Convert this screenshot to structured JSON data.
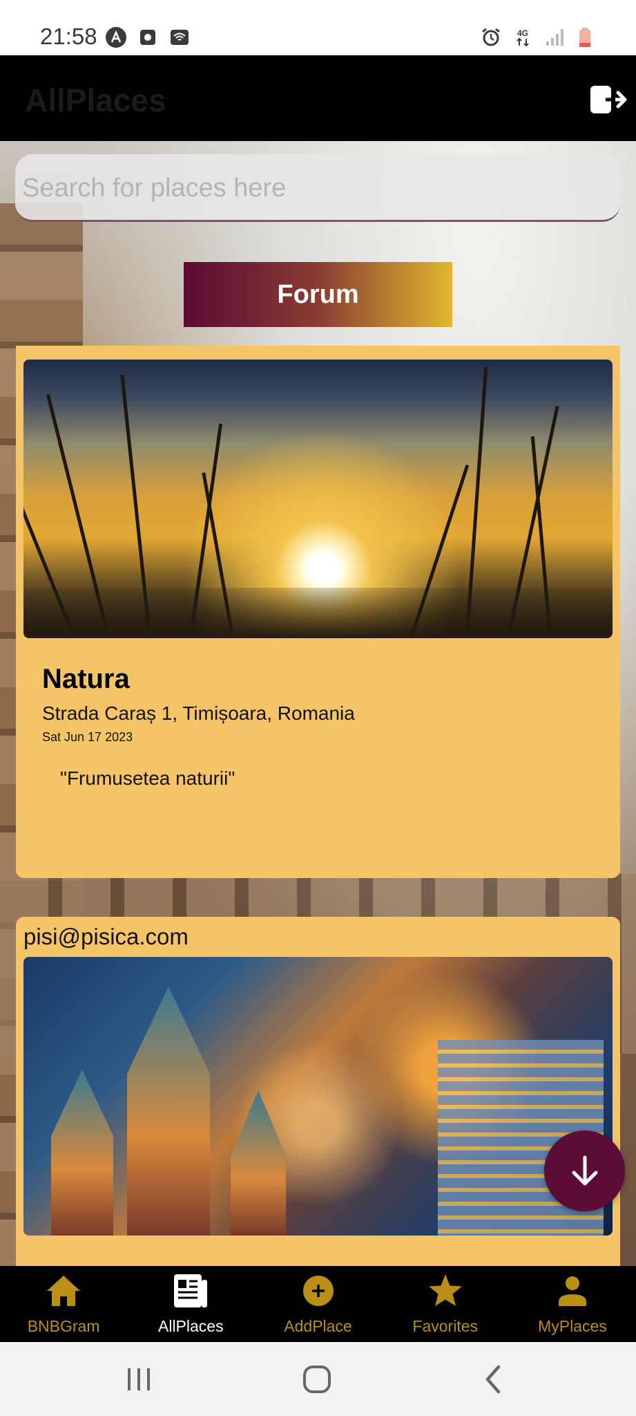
{
  "status_bar": {
    "time": "21:58",
    "network": "4G"
  },
  "app_bar": {
    "title": "AllPlaces",
    "logout_icon": "logout-icon"
  },
  "search": {
    "placeholder": "Search for places here"
  },
  "forum_button": {
    "label": "Forum"
  },
  "cards": [
    {
      "name": "Natura",
      "address": "Strada Caraș 1, Timișoara, Romania",
      "date": "Sat Jun 17 2023",
      "quote": "\"Frumusetea naturii\""
    },
    {
      "email": "pisi@pisica.com"
    }
  ],
  "nav": {
    "items": [
      {
        "label": "BNBGram",
        "icon": "home-icon"
      },
      {
        "label": "AllPlaces",
        "icon": "article-icon",
        "active": true
      },
      {
        "label": "AddPlace",
        "icon": "add-circle-icon"
      },
      {
        "label": "Favorites",
        "icon": "star-icon"
      },
      {
        "label": "MyPlaces",
        "icon": "person-icon"
      }
    ]
  },
  "colors": {
    "accent": "#b98f17",
    "card": "#f5c467",
    "fab": "#5c0d35"
  }
}
